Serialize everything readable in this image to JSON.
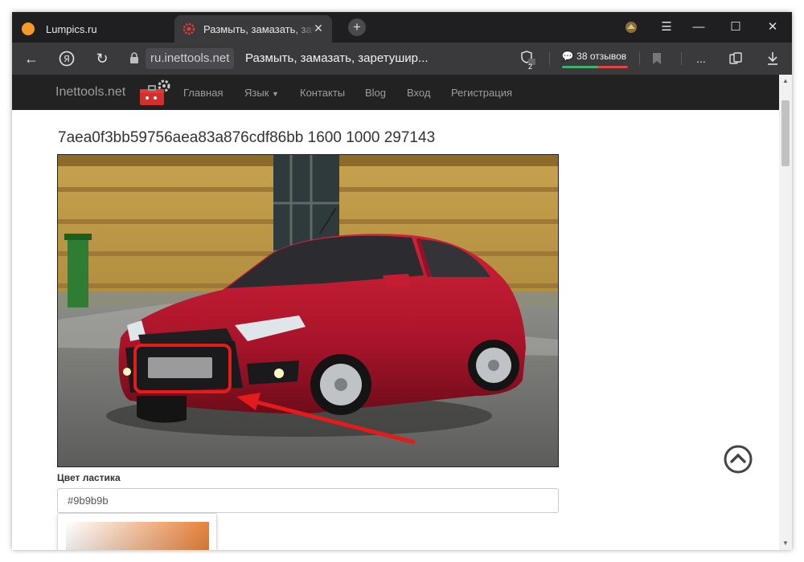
{
  "browser": {
    "tabs": [
      {
        "title": "Lumpics.ru",
        "active": false,
        "icon": "orange-circle-icon"
      },
      {
        "title": "Размыть, замазать, затереть",
        "active": true,
        "icon": "red-gear-icon"
      }
    ],
    "address": {
      "domain": "ru.inettools.net",
      "page_title": "Размыть, замазать, заретушир..."
    },
    "shield_badge": "2",
    "reviews_label": "38 отзывов",
    "more_label": "..."
  },
  "site": {
    "brand": "Inettools.net",
    "nav": [
      {
        "label": "Главная"
      },
      {
        "label": "Язык"
      },
      {
        "label": "Контакты"
      },
      {
        "label": "Blog"
      },
      {
        "label": "Вход"
      },
      {
        "label": "Регистрация"
      }
    ]
  },
  "main": {
    "heading": "7aea0f3bb59756aea83a876cdf86bb 1600 1000 297143",
    "eraser_label": "Цвет ластика",
    "eraser_value": "#9b9b9b"
  },
  "colors": {
    "accent_red": "#e31b1b",
    "car_red": "#b8182c",
    "eraser_color": "#9b9b9b"
  }
}
